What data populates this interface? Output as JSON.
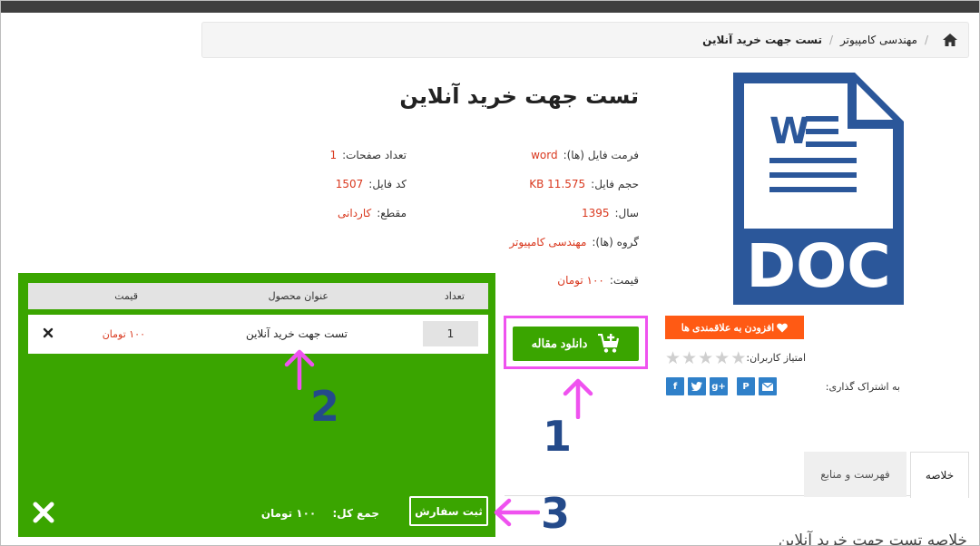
{
  "breadcrumb": {
    "category": "مهندسی کامپیوتر",
    "current": "تست جهت خرید آنلاین"
  },
  "product": {
    "title": "تست جهت خرید آنلاین",
    "doc_icon_letter": "W",
    "doc_icon_label": "DOC"
  },
  "specs": {
    "format_label": "فرمت فایل (ها):",
    "format_value": "word",
    "pages_label": "تعداد صفحات:",
    "pages_value": "1",
    "size_label": "حجم فایل:",
    "size_value": "11.575 KB",
    "code_label": "کد فایل:",
    "code_value": "1507",
    "year_label": "سال:",
    "year_value": "1395",
    "grade_label": "مقطع:",
    "grade_value": "کاردانی",
    "group_label": "گروه (ها):",
    "group_value": "مهندسی کامپیوتر",
    "price_label": "قیمت:",
    "price_value": "۱۰۰ تومان"
  },
  "actions": {
    "download_label": "دانلود مقاله",
    "wishlist_label": "افزودن به علاقمندی ها",
    "rating_label": "امتیاز کاربران:",
    "rating_value": 0,
    "rating_max": 5,
    "share_label": "به اشتراک گذاری:",
    "share_icons": [
      "facebook-icon",
      "twitter-icon",
      "google-plus-icon",
      "pinterest-icon",
      "email-icon"
    ]
  },
  "tabs": {
    "summary": "خلاصه",
    "index": "فهرست و منابع",
    "summary_heading": "خلاصه تست جهت خرید آنلاین"
  },
  "cart": {
    "columns": {
      "qty": "تعداد",
      "title": "عنوان محصول",
      "price": "قیمت"
    },
    "item": {
      "qty": "1",
      "title": "تست جهت خرید آنلاین",
      "price": "۱۰۰ تومان"
    },
    "total_label": "جمع کل:",
    "total_value": "۱۰۰ تومان",
    "order_button": "ثبت سفارش"
  },
  "callouts": {
    "one": "1",
    "two": "2",
    "three": "3"
  },
  "colors": {
    "green": "#3aa500",
    "orange": "#ff5a14",
    "value_red": "#d9381e",
    "callout_pink": "#ef52ef",
    "callout_blue": "#244a8a",
    "doc_blue": "#2b579a",
    "share_blue": "#2f80c9"
  }
}
